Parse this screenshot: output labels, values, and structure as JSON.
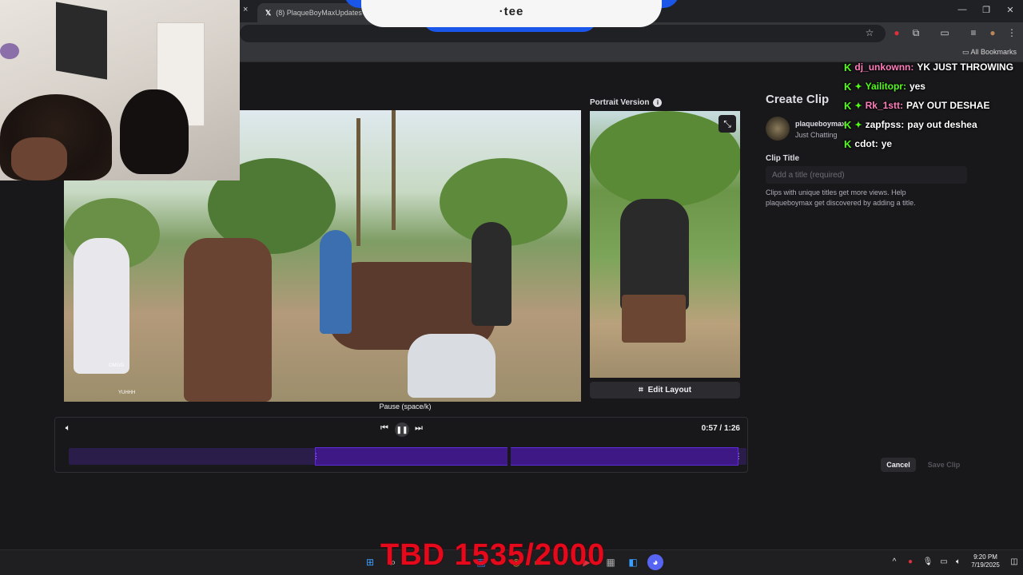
{
  "browser": {
    "tab_title": "(8) PlaqueBoyMaxUpdates on",
    "tab_close": "×",
    "bookmarks_label": "All Bookmarks",
    "window_controls": [
      "—",
      "❐",
      "✕"
    ]
  },
  "overlay_banner": {
    "text": "·tee"
  },
  "portrait": {
    "label": "Portrait Version",
    "edit_layout_label": "Edit Layout"
  },
  "player": {
    "tooltip": "Pause (space/k)",
    "time": "0:57 / 1:26",
    "selection_start_fraction": 0.36,
    "selection_end_fraction": 0.99
  },
  "video_chat_overlay": [
    "OMGG",
    "YUHHH"
  ],
  "clip_panel": {
    "title": "Create Clip",
    "streamer": "plaqueboymax",
    "category": "Just Chatting",
    "clip_title_label": "Clip Title",
    "clip_title_placeholder": "Add a title (required)",
    "clip_title_value": "",
    "help_text": "Clips with unique titles get more views. Help plaqueboymax get discovered by adding a title.",
    "cancel_label": "Cancel",
    "save_label": "Save Clip"
  },
  "chat": [
    {
      "user": "dj_unkownn:",
      "message": "YK JUST THROWING",
      "color": "#ff7dbb",
      "badges": [
        "kick"
      ]
    },
    {
      "user": "Yailitopr:",
      "message": "yes",
      "color": "#53fc18",
      "badges": [
        "kick",
        "sparkle"
      ]
    },
    {
      "user": "Rk_1stt:",
      "message": "PAY OUT DESHAE",
      "color": "#ff7dbb",
      "badges": [
        "kick",
        "sparkle"
      ]
    },
    {
      "user": "zapfpss:",
      "message": "pay out deshea",
      "color": "#ffffff",
      "badges": [
        "kick",
        "sparkle"
      ]
    },
    {
      "user": "cdot:",
      "message": "ye",
      "color": "#ffffff",
      "badges": [
        "kick"
      ]
    }
  ],
  "stream_goal": {
    "text": "TBD 1535/2000",
    "color": "#e5091b"
  },
  "taskbar": {
    "time": "9:20 PM",
    "date": "7/19/2025"
  }
}
